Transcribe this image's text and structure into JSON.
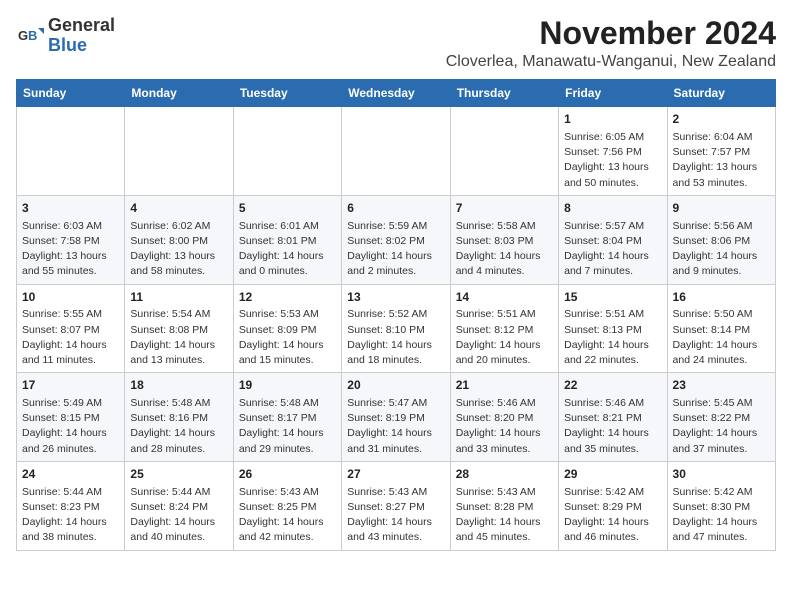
{
  "header": {
    "logo_general": "General",
    "logo_blue": "Blue",
    "month_title": "November 2024",
    "location": "Cloverlea, Manawatu-Wanganui, New Zealand"
  },
  "days_of_week": [
    "Sunday",
    "Monday",
    "Tuesday",
    "Wednesday",
    "Thursday",
    "Friday",
    "Saturday"
  ],
  "weeks": [
    [
      {
        "day": "",
        "info": ""
      },
      {
        "day": "",
        "info": ""
      },
      {
        "day": "",
        "info": ""
      },
      {
        "day": "",
        "info": ""
      },
      {
        "day": "",
        "info": ""
      },
      {
        "day": "1",
        "info": "Sunrise: 6:05 AM\nSunset: 7:56 PM\nDaylight: 13 hours\nand 50 minutes."
      },
      {
        "day": "2",
        "info": "Sunrise: 6:04 AM\nSunset: 7:57 PM\nDaylight: 13 hours\nand 53 minutes."
      }
    ],
    [
      {
        "day": "3",
        "info": "Sunrise: 6:03 AM\nSunset: 7:58 PM\nDaylight: 13 hours\nand 55 minutes."
      },
      {
        "day": "4",
        "info": "Sunrise: 6:02 AM\nSunset: 8:00 PM\nDaylight: 13 hours\nand 58 minutes."
      },
      {
        "day": "5",
        "info": "Sunrise: 6:01 AM\nSunset: 8:01 PM\nDaylight: 14 hours\nand 0 minutes."
      },
      {
        "day": "6",
        "info": "Sunrise: 5:59 AM\nSunset: 8:02 PM\nDaylight: 14 hours\nand 2 minutes."
      },
      {
        "day": "7",
        "info": "Sunrise: 5:58 AM\nSunset: 8:03 PM\nDaylight: 14 hours\nand 4 minutes."
      },
      {
        "day": "8",
        "info": "Sunrise: 5:57 AM\nSunset: 8:04 PM\nDaylight: 14 hours\nand 7 minutes."
      },
      {
        "day": "9",
        "info": "Sunrise: 5:56 AM\nSunset: 8:06 PM\nDaylight: 14 hours\nand 9 minutes."
      }
    ],
    [
      {
        "day": "10",
        "info": "Sunrise: 5:55 AM\nSunset: 8:07 PM\nDaylight: 14 hours\nand 11 minutes."
      },
      {
        "day": "11",
        "info": "Sunrise: 5:54 AM\nSunset: 8:08 PM\nDaylight: 14 hours\nand 13 minutes."
      },
      {
        "day": "12",
        "info": "Sunrise: 5:53 AM\nSunset: 8:09 PM\nDaylight: 14 hours\nand 15 minutes."
      },
      {
        "day": "13",
        "info": "Sunrise: 5:52 AM\nSunset: 8:10 PM\nDaylight: 14 hours\nand 18 minutes."
      },
      {
        "day": "14",
        "info": "Sunrise: 5:51 AM\nSunset: 8:12 PM\nDaylight: 14 hours\nand 20 minutes."
      },
      {
        "day": "15",
        "info": "Sunrise: 5:51 AM\nSunset: 8:13 PM\nDaylight: 14 hours\nand 22 minutes."
      },
      {
        "day": "16",
        "info": "Sunrise: 5:50 AM\nSunset: 8:14 PM\nDaylight: 14 hours\nand 24 minutes."
      }
    ],
    [
      {
        "day": "17",
        "info": "Sunrise: 5:49 AM\nSunset: 8:15 PM\nDaylight: 14 hours\nand 26 minutes."
      },
      {
        "day": "18",
        "info": "Sunrise: 5:48 AM\nSunset: 8:16 PM\nDaylight: 14 hours\nand 28 minutes."
      },
      {
        "day": "19",
        "info": "Sunrise: 5:48 AM\nSunset: 8:17 PM\nDaylight: 14 hours\nand 29 minutes."
      },
      {
        "day": "20",
        "info": "Sunrise: 5:47 AM\nSunset: 8:19 PM\nDaylight: 14 hours\nand 31 minutes."
      },
      {
        "day": "21",
        "info": "Sunrise: 5:46 AM\nSunset: 8:20 PM\nDaylight: 14 hours\nand 33 minutes."
      },
      {
        "day": "22",
        "info": "Sunrise: 5:46 AM\nSunset: 8:21 PM\nDaylight: 14 hours\nand 35 minutes."
      },
      {
        "day": "23",
        "info": "Sunrise: 5:45 AM\nSunset: 8:22 PM\nDaylight: 14 hours\nand 37 minutes."
      }
    ],
    [
      {
        "day": "24",
        "info": "Sunrise: 5:44 AM\nSunset: 8:23 PM\nDaylight: 14 hours\nand 38 minutes."
      },
      {
        "day": "25",
        "info": "Sunrise: 5:44 AM\nSunset: 8:24 PM\nDaylight: 14 hours\nand 40 minutes."
      },
      {
        "day": "26",
        "info": "Sunrise: 5:43 AM\nSunset: 8:25 PM\nDaylight: 14 hours\nand 42 minutes."
      },
      {
        "day": "27",
        "info": "Sunrise: 5:43 AM\nSunset: 8:27 PM\nDaylight: 14 hours\nand 43 minutes."
      },
      {
        "day": "28",
        "info": "Sunrise: 5:43 AM\nSunset: 8:28 PM\nDaylight: 14 hours\nand 45 minutes."
      },
      {
        "day": "29",
        "info": "Sunrise: 5:42 AM\nSunset: 8:29 PM\nDaylight: 14 hours\nand 46 minutes."
      },
      {
        "day": "30",
        "info": "Sunrise: 5:42 AM\nSunset: 8:30 PM\nDaylight: 14 hours\nand 47 minutes."
      }
    ]
  ]
}
